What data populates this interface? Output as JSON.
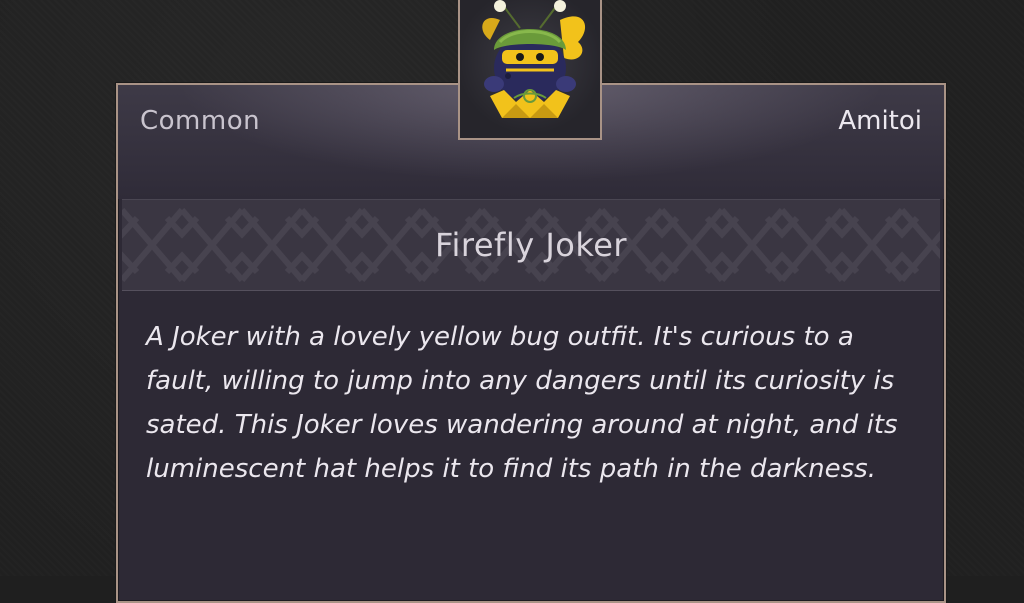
{
  "item": {
    "rarity": "Common",
    "category": "Amitoi",
    "name": "Firefly Joker",
    "description": "A Joker with a lovely yellow bug outfit. It's curious to a fault, willing to jump into any dangers until its curiosity is sated. This Joker loves wandering around at night, and its luminescent hat helps it to find its path in the darkness."
  },
  "portrait": {
    "icon": "firefly-joker-icon",
    "colors": {
      "body": "#2a2a5c",
      "hat": "#6a9a3a",
      "accent": "#f2c21b",
      "face": "#1a1a1a"
    }
  },
  "colors": {
    "frame_border": "#a99386",
    "panel": "#2d2935",
    "title_band": "#3a3642",
    "text_primary": "#ebe7ee",
    "text_muted": "#c9c4ce"
  }
}
